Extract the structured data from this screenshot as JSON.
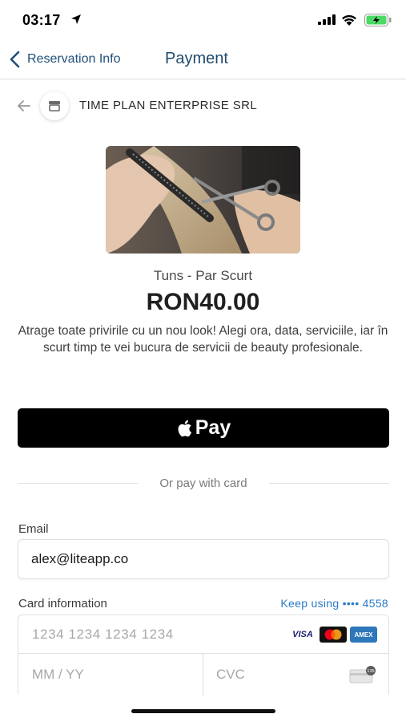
{
  "status_bar": {
    "time": "03:17"
  },
  "nav": {
    "back_label": "Reservation Info",
    "title": "Payment"
  },
  "merchant": {
    "name": "TIME PLAN ENTERPRISE SRL"
  },
  "product": {
    "name": "Tuns - Par Scurt",
    "price": "RON40.00",
    "description": "Atrage toate privirile cu un nou look! Alegi ora, data, serviciile, iar în scurt timp te vei bucura de servicii de beauty profesionale."
  },
  "apple_pay": {
    "label": "Pay"
  },
  "divider": {
    "text": "Or pay with card"
  },
  "email": {
    "label": "Email",
    "value": "alex@liteapp.co"
  },
  "card": {
    "label": "Card information",
    "keep_using": "Keep using •••• 4558",
    "number_placeholder": "1234 1234 1234 1234",
    "expiry_placeholder": "MM / YY",
    "cvc_placeholder": "CVC",
    "brands": [
      "VISA",
      "mastercard",
      "AMEX"
    ],
    "cvc_badge": "135"
  },
  "colors": {
    "nav_accent": "#1f4f7a",
    "link": "#2a7cc7",
    "apple_pay_bg": "#000000",
    "battery": "#4cd964"
  }
}
